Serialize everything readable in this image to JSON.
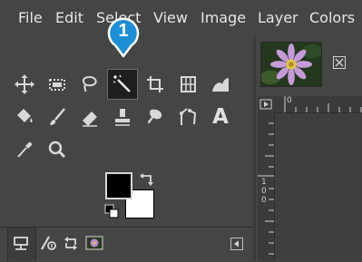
{
  "menubar": {
    "items": [
      {
        "label": "File"
      },
      {
        "label": "Edit"
      },
      {
        "label": "Select"
      },
      {
        "label": "View"
      },
      {
        "label": "Image"
      },
      {
        "label": "Layer"
      },
      {
        "label": "Colors"
      }
    ]
  },
  "callout": {
    "number": "1",
    "color": "#1d8fd6"
  },
  "toolbox": {
    "tools": [
      {
        "icon": "move-icon"
      },
      {
        "icon": "rect-select-icon"
      },
      {
        "icon": "free-select-icon"
      },
      {
        "icon": "fuzzy-select-icon",
        "active": true
      },
      {
        "icon": "crop-icon"
      },
      {
        "icon": "unified-transform-icon"
      },
      {
        "icon": "warp-transform-icon"
      },
      {
        "icon": "bucket-fill-icon"
      },
      {
        "icon": "paintbrush-icon"
      },
      {
        "icon": "eraser-icon"
      },
      {
        "icon": "clone-icon"
      },
      {
        "icon": "smudge-icon"
      },
      {
        "icon": "paths-icon"
      },
      {
        "icon": "text-tool-icon",
        "label": "A"
      },
      {
        "icon": "color-picker-icon"
      },
      {
        "icon": "zoom-icon"
      }
    ],
    "foreground_color": "#000000",
    "background_color": "#ffffff"
  },
  "bottom_tabs": [
    {
      "icon": "tool-options-icon"
    },
    {
      "icon": "device-status-icon"
    },
    {
      "icon": "undo-history-icon"
    },
    {
      "icon": "images-icon"
    }
  ],
  "canvas": {
    "ruler_top_label": "0",
    "ruler_left_labels": [
      "1",
      "0",
      "0"
    ]
  }
}
